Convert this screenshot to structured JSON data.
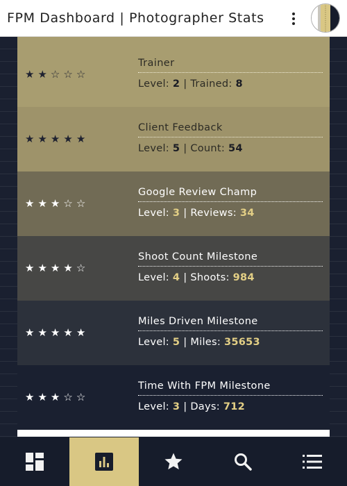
{
  "header": {
    "title": "FPM Dashboard | Photographer Stats",
    "menu_icon": "kebab-menu-icon",
    "avatar_icon": "avatar"
  },
  "colors": {
    "dark_navy": "#161c2b",
    "gold": "#d9c784",
    "khaki": "#a89d70",
    "olive": "#6b6650",
    "slate": "#4a4a48"
  },
  "achievements": [
    {
      "title": "Trainer",
      "rating": 2,
      "level_label": "Level:",
      "level": "2",
      "sep": "|",
      "count_label": "Trained:",
      "count": "8",
      "bg": "#a89d70",
      "text": "#2b2a24",
      "accent": "#1a1c24",
      "star_color": "#1f2230",
      "line": "#f4f0dc"
    },
    {
      "title": "Client Feedback",
      "rating": 5,
      "level_label": "Level:",
      "level": "5",
      "sep": "|",
      "count_label": "Count:",
      "count": "54",
      "bg": "#9e936a",
      "text": "#2b2a24",
      "accent": "#1a1c24",
      "star_color": "#1f2230",
      "line": "#f4f0dc"
    },
    {
      "title": "Google Review Champ",
      "rating": 3,
      "level_label": "Level:",
      "level": "3",
      "sep": "|",
      "count_label": "Reviews:",
      "count": "34",
      "bg": "#716b55",
      "text": "#ffffff",
      "accent": "#e3cf85",
      "star_color": "#ffffff",
      "line": "#ffffff"
    },
    {
      "title": "Shoot Count Milestone",
      "rating": 4,
      "level_label": "Level:",
      "level": "4",
      "sep": "|",
      "count_label": "Shoots:",
      "count": "984",
      "bg": "#474745",
      "text": "#ffffff",
      "accent": "#e3cf85",
      "star_color": "#ffffff",
      "line": "#ffffff"
    },
    {
      "title": "Miles Driven Milestone",
      "rating": 5,
      "level_label": "Level:",
      "level": "5",
      "sep": "|",
      "count_label": "Miles:",
      "count": "35653",
      "bg": "#2c313b",
      "text": "#ffffff",
      "accent": "#e3cf85",
      "star_color": "#ffffff",
      "line": "#ffffff"
    },
    {
      "title": "Time With FPM Milestone",
      "rating": 3,
      "level_label": "Level:",
      "level": "3",
      "sep": "|",
      "count_label": "Days:",
      "count": "712",
      "bg": "#1a2030",
      "text": "#ffffff",
      "accent": "#e3cf85",
      "star_color": "#ffffff",
      "line": "#ffffff"
    }
  ],
  "nav": [
    {
      "icon": "dashboard-icon",
      "active": false
    },
    {
      "icon": "stats-chart-icon",
      "active": true
    },
    {
      "icon": "star-icon",
      "active": false
    },
    {
      "icon": "search-icon",
      "active": false
    },
    {
      "icon": "list-menu-icon",
      "active": false
    }
  ]
}
